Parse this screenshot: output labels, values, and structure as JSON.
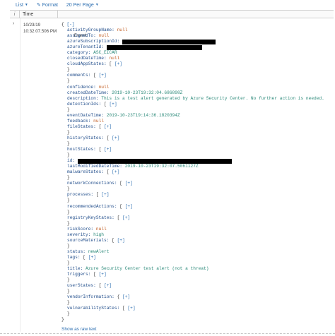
{
  "toolbar": {
    "list_label": "List",
    "format_label": "Format",
    "per_page_label": "20 Per Page"
  },
  "columns": {
    "info": "i",
    "time": "Time",
    "event": "Event"
  },
  "row": {
    "expander": "›",
    "date": "10/23/19",
    "time": "10:32:07.506 PM"
  },
  "event": {
    "open_brace": "{",
    "collapse_toggle": "[-]",
    "expand_toggle": "[+]",
    "close_brace": "}",
    "activityGroupName": {
      "key": "activityGroupName:",
      "value": "null"
    },
    "assignedTo": {
      "key": "assignedTo:",
      "value": "null"
    },
    "azureSubscriptionId": {
      "key": "azureSubscriptionId:"
    },
    "azureTenantId": {
      "key": "azureTenantId:"
    },
    "category": {
      "key": "category:",
      "value": "ASC_EICAR"
    },
    "closedDateTime": {
      "key": "closedDateTime:",
      "value": "null"
    },
    "cloudAppStates": {
      "key": "cloudAppStates:",
      "value": "["
    },
    "comments": {
      "key": "comments:",
      "value": "["
    },
    "confidence": {
      "key": "confidence:",
      "value": "null"
    },
    "createdDateTime": {
      "key": "createdDateTime:",
      "value": "2019-10-23T19:32:04.686898Z"
    },
    "description": {
      "key": "description:",
      "value": "This is a test alert generated by Azure Security Center. No further action is needed."
    },
    "detectionIds": {
      "key": "detectionIds:",
      "value": "["
    },
    "eventDateTime": {
      "key": "eventDateTime:",
      "value": "2019-10-23T19:14:36.1820394Z"
    },
    "feedback": {
      "key": "feedback:",
      "value": "null"
    },
    "fileStates": {
      "key": "fileStates:",
      "value": "["
    },
    "historyStates": {
      "key": "historyStates:",
      "value": "["
    },
    "hostStates": {
      "key": "hostStates:",
      "value": "["
    },
    "id": {
      "key": "id:"
    },
    "lastModifiedDateTime": {
      "key": "lastModifiedDateTime:",
      "value": "2019-10-23T19:32:07.5061127Z"
    },
    "malwareStates": {
      "key": "malwareStates:",
      "value": "["
    },
    "networkConnections": {
      "key": "networkConnections:",
      "value": "["
    },
    "processes": {
      "key": "processes:",
      "value": "["
    },
    "recommendedActions": {
      "key": "recommendedActions:",
      "value": "["
    },
    "registryKeyStates": {
      "key": "registryKeyStates:",
      "value": "["
    },
    "riskScore": {
      "key": "riskScore:",
      "value": "null"
    },
    "severity": {
      "key": "severity:",
      "value": "high"
    },
    "sourceMaterials": {
      "key": "sourceMaterials:",
      "value": "["
    },
    "status": {
      "key": "status:",
      "value": "newAlert"
    },
    "tags": {
      "key": "tags:",
      "value": "["
    },
    "title": {
      "key": "title:",
      "value": "Azure Security Center test alert (not a threat)"
    },
    "triggers": {
      "key": "triggers:",
      "value": "["
    },
    "userStates": {
      "key": "userStates:",
      "value": "["
    },
    "vendorInformation": {
      "key": "vendorInformation:",
      "value": "{"
    },
    "vulnerabilityStates": {
      "key": "vulnerabilityStates:",
      "value": "["
    }
  },
  "footer": {
    "raw_text_link": "Show as raw text"
  }
}
